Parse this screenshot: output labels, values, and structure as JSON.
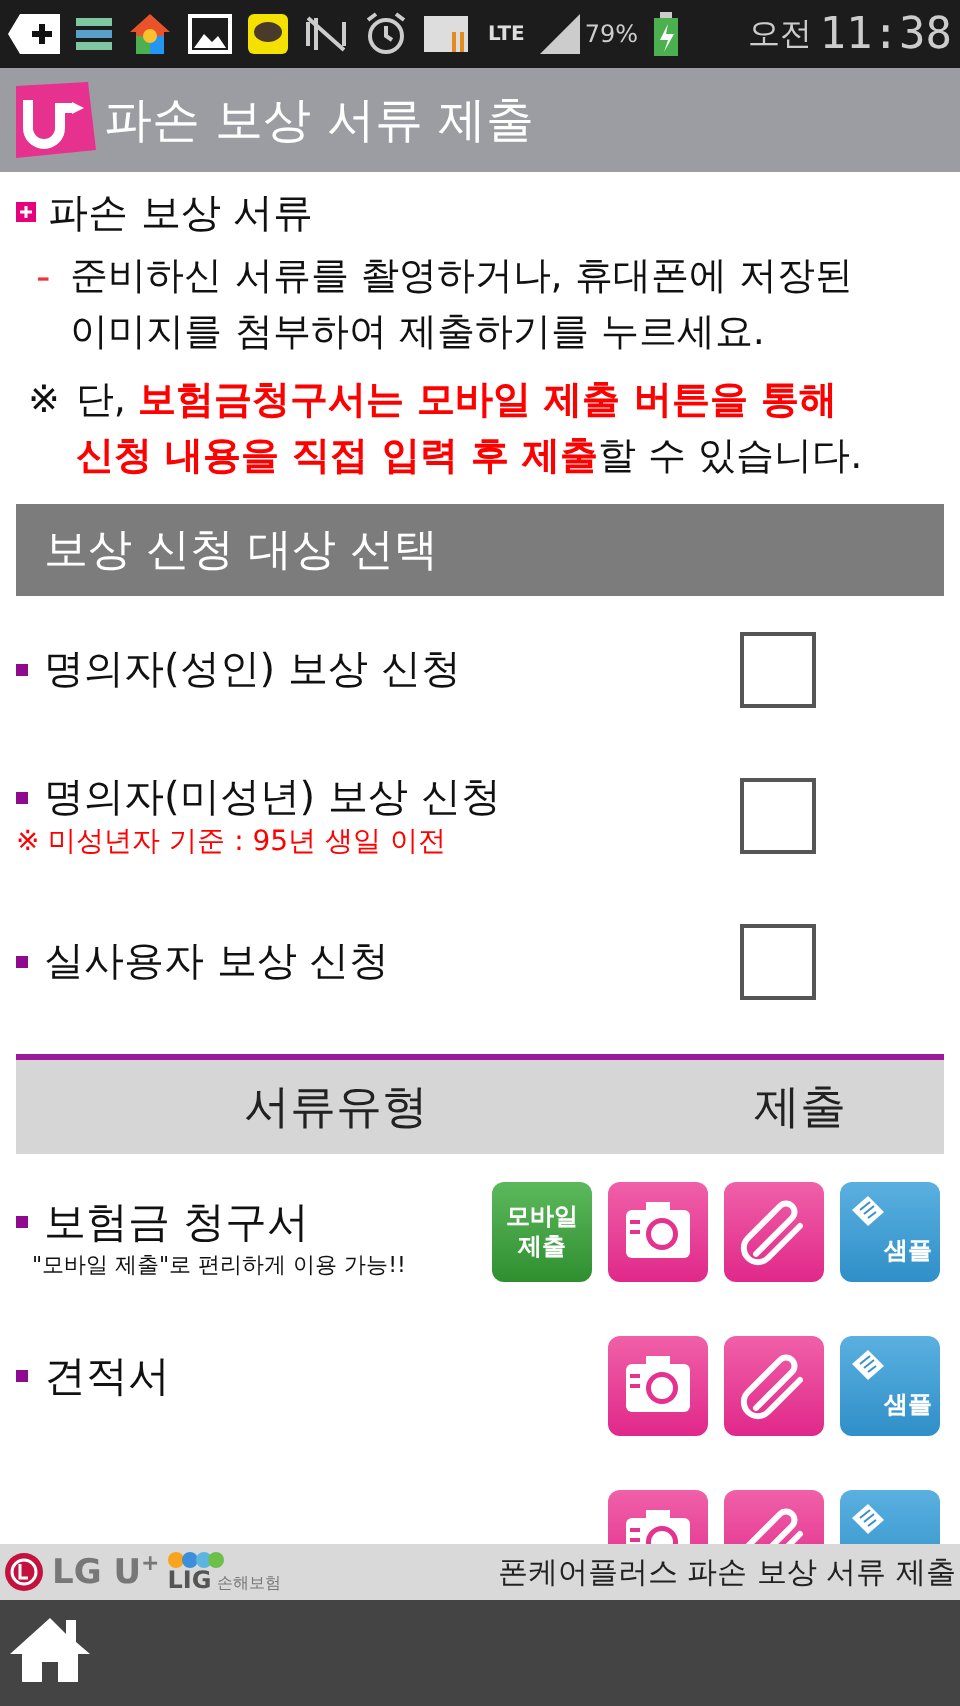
{
  "status_bar": {
    "network": "LTE",
    "battery": "79%",
    "ampm": "오전",
    "time": "11:38"
  },
  "title_bar": {
    "title": "파손 보상 서류 제출"
  },
  "intro": {
    "heading": "파손 보상 서류",
    "bullet": "-",
    "description": "준비하신 서류를 촬영하거나, 휴대폰에 저장된 이미지를 첨부하여 제출하기를 누르세요.",
    "note_mark": "※",
    "note": "단, **보험금청구서는 모바일 제출 버튼을 통해 신청 내용을 직접 입력 후 제출**할 수 있습니다."
  },
  "section": {
    "title": "보상 신청 대상 선택"
  },
  "options": [
    {
      "label": "명의자(성인) 보상 신청",
      "checked": false
    },
    {
      "label": "명의자(미성년) 보상 신청",
      "note": "※ 미성년자 기준 : 95년 생일 이전",
      "checked": false
    },
    {
      "label": "실사용자 보상 신청",
      "checked": false
    }
  ],
  "table": {
    "columns": [
      "서류유형",
      "제출"
    ],
    "rows": [
      {
        "label": "보험금 청구서",
        "hint": "\"모바일 제출\"로 편리하게 이용 가능!!",
        "buttons": [
          {
            "kind": "mobile",
            "label": "모바일 제출"
          },
          {
            "kind": "camera"
          },
          {
            "kind": "attach"
          },
          {
            "kind": "sample",
            "label": "샘플"
          }
        ]
      },
      {
        "label": "견적서",
        "buttons": [
          {
            "kind": "camera"
          },
          {
            "kind": "attach"
          },
          {
            "kind": "sample",
            "label": "샘플"
          }
        ]
      },
      {
        "buttons": [
          {
            "kind": "camera"
          },
          {
            "kind": "attach"
          },
          {
            "kind": "sample"
          }
        ]
      }
    ]
  },
  "footer": {
    "brand": "LG U",
    "brand_sup": "+",
    "partner": "LIG",
    "partner_sub": "손해보험",
    "caption": "폰케어플러스 파손 보상 서류 제출"
  }
}
